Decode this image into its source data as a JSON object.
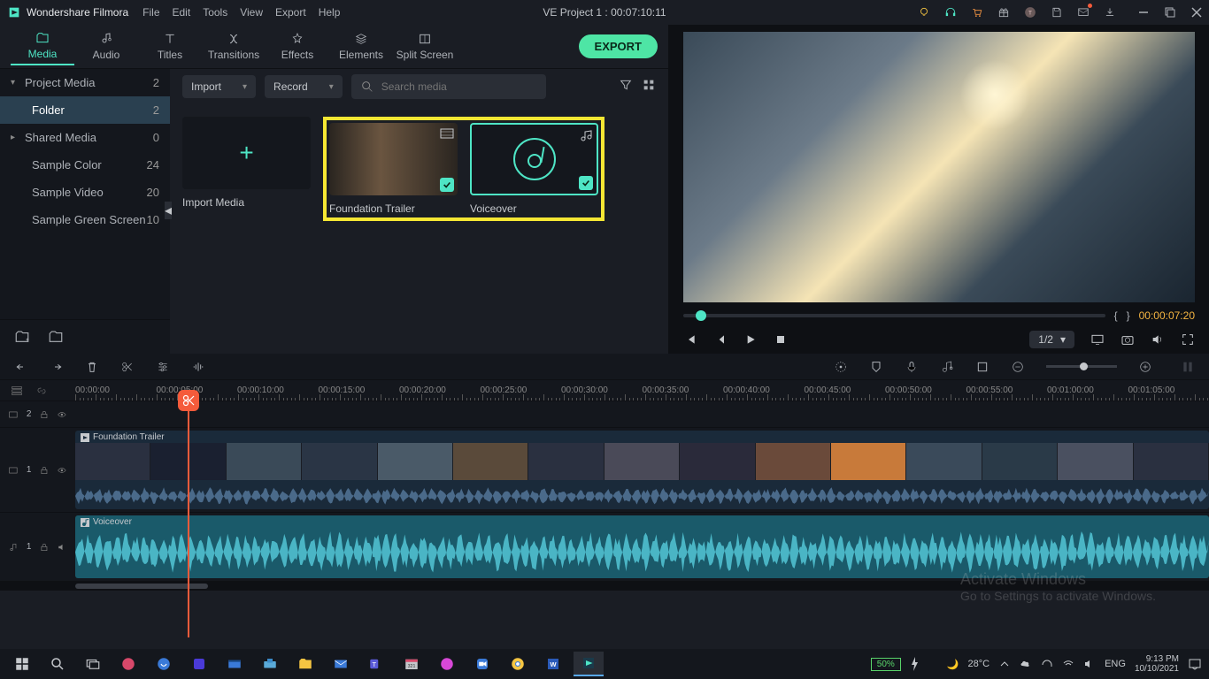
{
  "app_name": "Wondershare Filmora",
  "menus": [
    "File",
    "Edit",
    "Tools",
    "View",
    "Export",
    "Help"
  ],
  "title_center": "VE Project 1 : 00:07:10:11",
  "tabs": [
    {
      "label": "Media",
      "icon": "folder",
      "active": true
    },
    {
      "label": "Audio",
      "icon": "music"
    },
    {
      "label": "Titles",
      "icon": "text"
    },
    {
      "label": "Transitions",
      "icon": "shuffle"
    },
    {
      "label": "Effects",
      "icon": "sparkle"
    },
    {
      "label": "Elements",
      "icon": "stack"
    },
    {
      "label": "Split Screen",
      "icon": "grid"
    }
  ],
  "export_label": "EXPORT",
  "sidebar": [
    {
      "label": "Project Media",
      "count": "2",
      "caret": "▾"
    },
    {
      "label": "Folder",
      "count": "2",
      "active": true,
      "indent": true
    },
    {
      "label": "Shared Media",
      "count": "0",
      "caret": "▸"
    },
    {
      "label": "Sample Color",
      "count": "24",
      "indent": true
    },
    {
      "label": "Sample Video",
      "count": "20",
      "indent": true
    },
    {
      "label": "Sample Green Screen",
      "count": "10",
      "indent": true
    }
  ],
  "media_tools": {
    "import": "Import",
    "record": "Record",
    "search_ph": "Search media"
  },
  "thumbs": {
    "import": "Import Media",
    "trailer": "Foundation Trailer",
    "voiceover": "Voiceover"
  },
  "scrub": {
    "lbrace": "{",
    "rbrace": "}",
    "time": "00:00:07:20"
  },
  "player": {
    "page": "1/2"
  },
  "timeline": {
    "ticks": [
      "00:00:00",
      "00:00:05:00",
      "00:00:10:00",
      "00:00:15:00",
      "00:00:20:00",
      "00:00:25:00",
      "00:00:30:00",
      "00:00:35:00",
      "00:00:40:00",
      "00:00:45:00",
      "00:00:50:00",
      "00:00:55:00",
      "00:01:00:00",
      "00:01:05:00"
    ],
    "track_e": "2",
    "track_v": "1",
    "track_a": "1",
    "clip_video": "Foundation Trailer",
    "clip_audio": "Voiceover"
  },
  "watermark": {
    "line1": "Activate Windows",
    "line2": "Go to Settings to activate Windows."
  },
  "taskbar": {
    "battery": "50%",
    "temp": "28°C",
    "lang": "ENG",
    "time": "9:13 PM",
    "date": "10/10/2021"
  }
}
